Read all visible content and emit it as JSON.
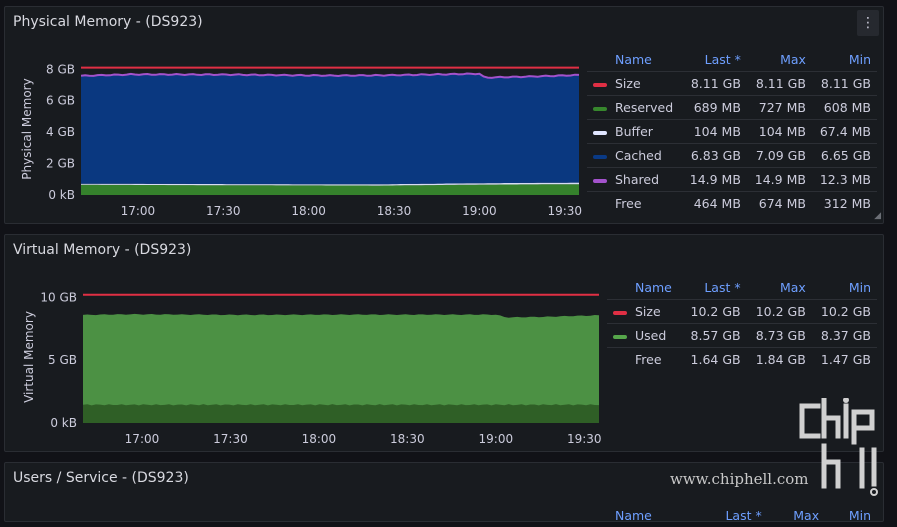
{
  "panels": {
    "physical": {
      "title": "Physical Memory - (DS923)",
      "legend_headers": {
        "name": "Name",
        "last": "Last *",
        "max": "Max",
        "min": "Min"
      },
      "rows": [
        {
          "name": "Size",
          "last": "8.11 GB",
          "max": "8.11 GB",
          "min": "8.11 GB",
          "color": "#e02f44"
        },
        {
          "name": "Reserved",
          "last": "689 MB",
          "max": "727 MB",
          "min": "608 MB",
          "color": "#37872d"
        },
        {
          "name": "Buffer",
          "last": "104 MB",
          "max": "104 MB",
          "min": "67.4 MB",
          "color": "#e0e6ff"
        },
        {
          "name": "Cached",
          "last": "6.83 GB",
          "max": "7.09 GB",
          "min": "6.65 GB",
          "color": "#0a3a86"
        },
        {
          "name": "Shared",
          "last": "14.9 MB",
          "max": "14.9 MB",
          "min": "12.3 MB",
          "color": "#a352cc"
        },
        {
          "name": "Free",
          "last": "464 MB",
          "max": "674 MB",
          "min": "312 MB",
          "color": ""
        }
      ]
    },
    "virtual": {
      "title": "Virtual Memory - (DS923)",
      "legend_headers": {
        "name": "Name",
        "last": "Last *",
        "max": "Max",
        "min": "Min"
      },
      "rows": [
        {
          "name": "Size",
          "last": "10.2 GB",
          "max": "10.2 GB",
          "min": "10.2 GB",
          "color": "#e02f44"
        },
        {
          "name": "Used",
          "last": "8.57 GB",
          "max": "8.73 GB",
          "min": "8.37 GB",
          "color": "#56a64b"
        },
        {
          "name": "Free",
          "last": "1.64 GB",
          "max": "1.84 GB",
          "min": "1.47 GB",
          "color": ""
        }
      ]
    },
    "users": {
      "title": "Users / Service - (DS923)",
      "legend_headers": {
        "name": "Name",
        "last": "Last *",
        "max": "Max",
        "min": "Min"
      }
    }
  },
  "menu_icon": "kebab-menu-icon",
  "watermark": {
    "text": "www.chiphell.com",
    "logo_letters": "chip hell"
  },
  "chart_data": [
    {
      "type": "area",
      "title": "Physical Memory - (DS923)",
      "ylabel": "Physical Memory",
      "xlabel": "",
      "x_ticks": [
        "17:00",
        "17:30",
        "18:00",
        "18:30",
        "19:00",
        "19:30"
      ],
      "x_range": [
        "16:40",
        "19:35"
      ],
      "y_ticks": [
        "0 kB",
        "2 GB",
        "4 GB",
        "6 GB",
        "8 GB"
      ],
      "ylim": [
        0,
        8.4
      ],
      "stacked": true,
      "series": [
        {
          "name": "Size",
          "style": "line",
          "color": "#e02f44",
          "unit": "GB",
          "points": [
            [
              0,
              8.11
            ],
            [
              1,
              8.11
            ]
          ]
        },
        {
          "name": "Reserved",
          "style": "area",
          "color": "#37872d",
          "unit": "GB",
          "points": [
            [
              0,
              0.65
            ],
            [
              0.3,
              0.62
            ],
            [
              0.6,
              0.6
            ],
            [
              0.8,
              0.66
            ],
            [
              1,
              0.69
            ]
          ]
        },
        {
          "name": "Buffer",
          "style": "area",
          "color": "#e0e6ff",
          "unit": "GB",
          "points": [
            [
              0,
              0.07
            ],
            [
              0.5,
              0.08
            ],
            [
              1,
              0.1
            ]
          ]
        },
        {
          "name": "Cached",
          "style": "area",
          "color": "#0a3a86",
          "unit": "GB",
          "points": [
            [
              0,
              6.85
            ],
            [
              0.1,
              6.95
            ],
            [
              0.3,
              6.95
            ],
            [
              0.5,
              6.9
            ],
            [
              0.8,
              6.95
            ],
            [
              0.81,
              6.7
            ],
            [
              0.9,
              6.75
            ],
            [
              1,
              6.83
            ]
          ]
        },
        {
          "name": "Shared",
          "style": "line",
          "color": "#a352cc",
          "unit": "GB",
          "points": [
            [
              0,
              0.013
            ],
            [
              1,
              0.015
            ]
          ]
        }
      ]
    },
    {
      "type": "area",
      "title": "Virtual Memory - (DS923)",
      "ylabel": "Virtual Memory",
      "xlabel": "",
      "x_ticks": [
        "17:00",
        "17:30",
        "18:00",
        "18:30",
        "19:00",
        "19:30"
      ],
      "x_range": [
        "16:40",
        "19:35"
      ],
      "y_ticks": [
        "0 kB",
        "5 GB",
        "10 GB"
      ],
      "ylim": [
        0,
        10.5
      ],
      "series": [
        {
          "name": "Size",
          "style": "line",
          "color": "#e02f44",
          "unit": "GB",
          "points": [
            [
              0,
              10.2
            ],
            [
              1,
              10.2
            ]
          ]
        },
        {
          "name": "Used",
          "style": "area",
          "color": "#56a64b",
          "unit": "GB",
          "points": [
            [
              0,
              8.6
            ],
            [
              0.1,
              8.65
            ],
            [
              0.3,
              8.6
            ],
            [
              0.5,
              8.62
            ],
            [
              0.8,
              8.62
            ],
            [
              0.82,
              8.4
            ],
            [
              0.9,
              8.45
            ],
            [
              1,
              8.57
            ]
          ]
        }
      ]
    }
  ]
}
